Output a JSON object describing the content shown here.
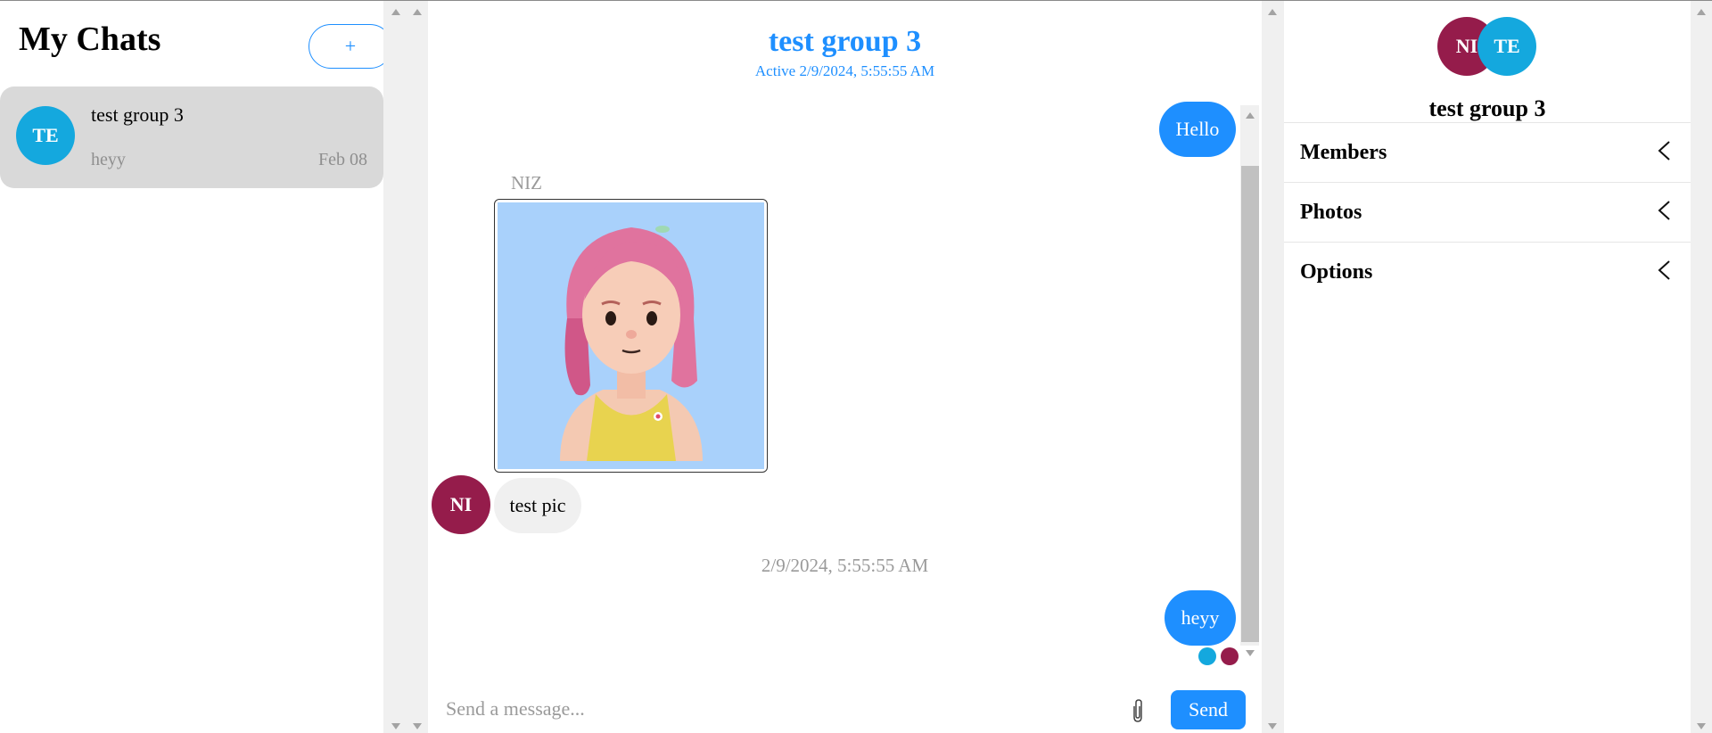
{
  "sidebar": {
    "title": "My Chats",
    "new_chat_label": "+",
    "chats": [
      {
        "initials": "TE",
        "name": "test group 3",
        "last_message": "heyy",
        "date": "Feb 08"
      }
    ]
  },
  "conversation": {
    "title": "test group 3",
    "active": "Active 2/9/2024, 5:55:55 AM",
    "messages": [
      {
        "text": "Hello"
      },
      {
        "sender": "NIZ"
      },
      {
        "sender_initials": "NI",
        "text": "test pic"
      },
      {
        "timestamp": "2/9/2024, 5:55:55 AM"
      },
      {
        "text": "heyy"
      }
    ],
    "input_placeholder": "Send a message...",
    "send_label": "Send"
  },
  "details": {
    "avatars": [
      "NI",
      "TE"
    ],
    "group_name": "test group 3",
    "sections": [
      "Members",
      "Photos",
      "Options"
    ]
  },
  "colors": {
    "accent": "#1e8fff",
    "te_avatar": "#14a8de",
    "ni_avatar": "#951c4b",
    "selected_chat": "#d9d9d9"
  }
}
